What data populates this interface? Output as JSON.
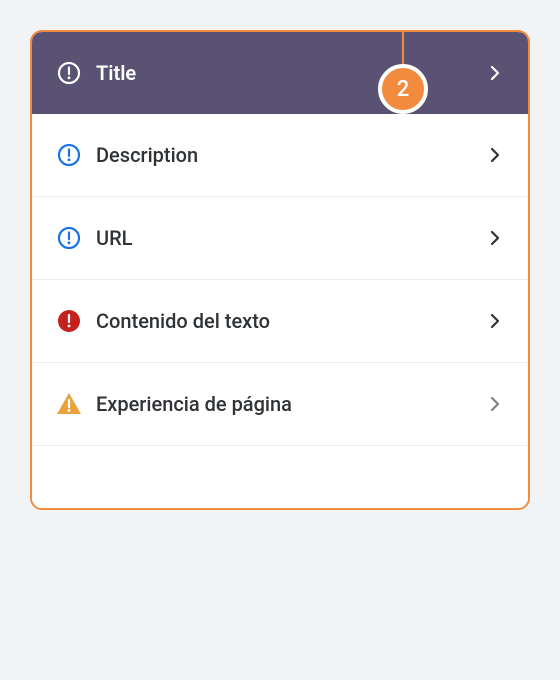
{
  "badge": {
    "count": "2"
  },
  "colors": {
    "accent": "#f28b3e",
    "header": "#5a5272",
    "info": "#1a73e8",
    "error": "#c5221f",
    "warning": "#e8a33d"
  },
  "header": {
    "icon": "alert-circle-outline-icon",
    "label": "Title"
  },
  "rows": [
    {
      "icon": "alert-circle-outline-icon",
      "iconColor": "info",
      "label": "Description"
    },
    {
      "icon": "alert-circle-outline-icon",
      "iconColor": "info",
      "label": "URL"
    },
    {
      "icon": "alert-circle-filled-icon",
      "iconColor": "error",
      "label": "Contenido del texto"
    },
    {
      "icon": "alert-triangle-icon",
      "iconColor": "warning",
      "label": "Experiencia de página"
    }
  ]
}
